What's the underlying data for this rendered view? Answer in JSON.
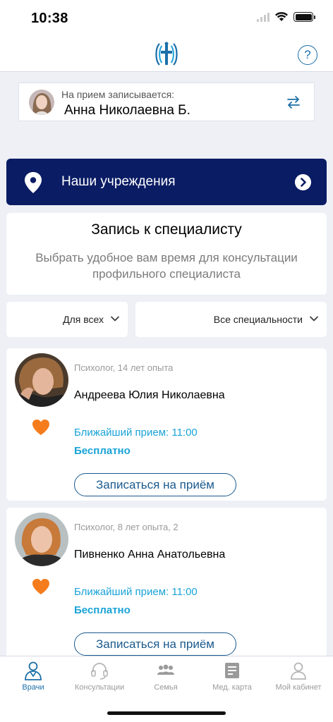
{
  "status_bar": {
    "time": "10:38"
  },
  "header": {
    "logo_icon": "spine-cross-logo",
    "help_label": "?"
  },
  "patient": {
    "caption": "На прием записывается:",
    "name": "Анна Николаевна Б.",
    "switch_icon": "swap-arrows-icon"
  },
  "institutions": {
    "label": "Наши учреждения",
    "icon": "location-pin-icon"
  },
  "booking": {
    "title": "Запись к специалисту",
    "subtitle": "Выбрать удобное вам время для консультации профильного специалиста"
  },
  "filters": {
    "audience": "Для всех",
    "specialty": "Все специальности"
  },
  "doctors": [
    {
      "meta": "Психолог, 14 лет опыта",
      "name": "Андреева Юлия Николаевна",
      "next": "Ближайший прием: 11:00",
      "price": "Бесплатно",
      "button": "Записаться на приём"
    },
    {
      "meta": "Психолог, 8 лет опыта, 2",
      "name": "Пивненко Анна Анатольевна",
      "next": "Ближайший прием: 11:00",
      "price": "Бесплатно",
      "button": "Записаться на приём"
    }
  ],
  "tabs": [
    {
      "label": "Врачи",
      "icon": "doctor-icon",
      "active": true
    },
    {
      "label": "Консультации",
      "icon": "headset-icon",
      "active": false
    },
    {
      "label": "Семья",
      "icon": "family-icon",
      "active": false
    },
    {
      "label": "Мед. карта",
      "icon": "medical-card-icon",
      "active": false
    },
    {
      "label": "Мой кабинет",
      "icon": "profile-icon",
      "active": false
    }
  ],
  "colors": {
    "brand_navy": "#0a1c64",
    "accent_blue": "#1aa3d8",
    "button_blue": "#1b5a8e",
    "heart_orange": "#f57c1c"
  }
}
